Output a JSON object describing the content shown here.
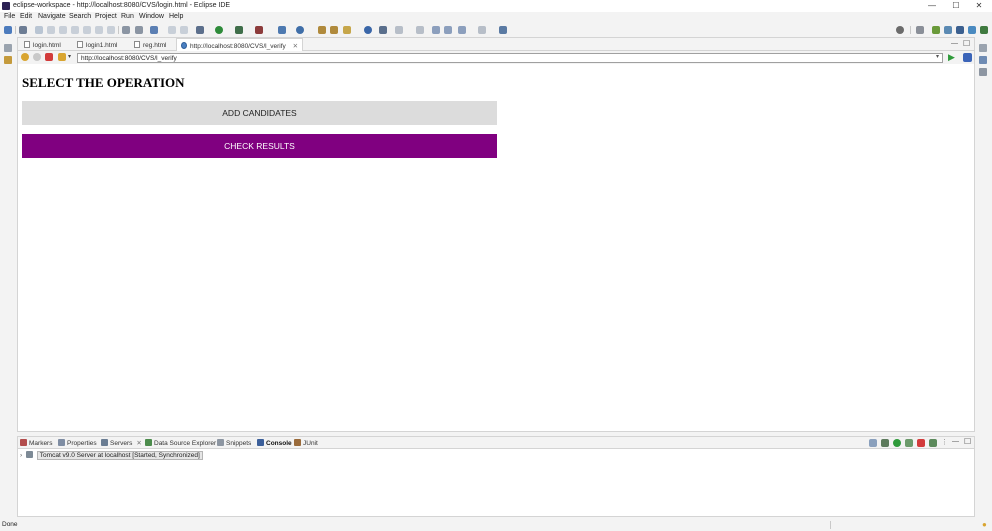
{
  "window": {
    "title": "eclipse-workspace - http://localhost:8080/CVS/login.html - Eclipse IDE",
    "minimize": "—",
    "maximize": "☐",
    "close": "✕"
  },
  "menu": [
    "File",
    "Edit",
    "Navigate",
    "Search",
    "Project",
    "Run",
    "Window",
    "Help"
  ],
  "editor_tabs": [
    {
      "label": "login.html",
      "icon": "html-file-icon"
    },
    {
      "label": "login1.html",
      "icon": "html-file-icon"
    },
    {
      "label": "reg.html",
      "icon": "html-file-icon"
    },
    {
      "label": "http://localhost:8080/CVS/l_verify",
      "icon": "browser-globe-icon",
      "active": true,
      "close": "✕"
    }
  ],
  "browser": {
    "url": "http://localhost:8080/CVS/l_verify"
  },
  "page": {
    "heading": "SELECT THE OPERATION",
    "add_button": "ADD CANDIDATES",
    "check_button": "CHECK RESULTS",
    "check_button_color": "#800080"
  },
  "panel": {
    "tabs": [
      {
        "label": "Markers",
        "icon": "markers-icon"
      },
      {
        "label": "Properties",
        "icon": "properties-icon"
      },
      {
        "label": "Servers",
        "icon": "servers-icon",
        "close": "✕"
      },
      {
        "label": "Data Source Explorer",
        "icon": "data-source-icon"
      },
      {
        "label": "Snippets",
        "icon": "snippets-icon"
      },
      {
        "label": "Console",
        "icon": "console-icon",
        "bold": true
      },
      {
        "label": "JUnit",
        "icon": "junit-icon"
      }
    ],
    "server_entry": "Tomcat v9.0 Server at localhost  [Started, Synchronized]"
  },
  "status": {
    "text": "Done"
  }
}
